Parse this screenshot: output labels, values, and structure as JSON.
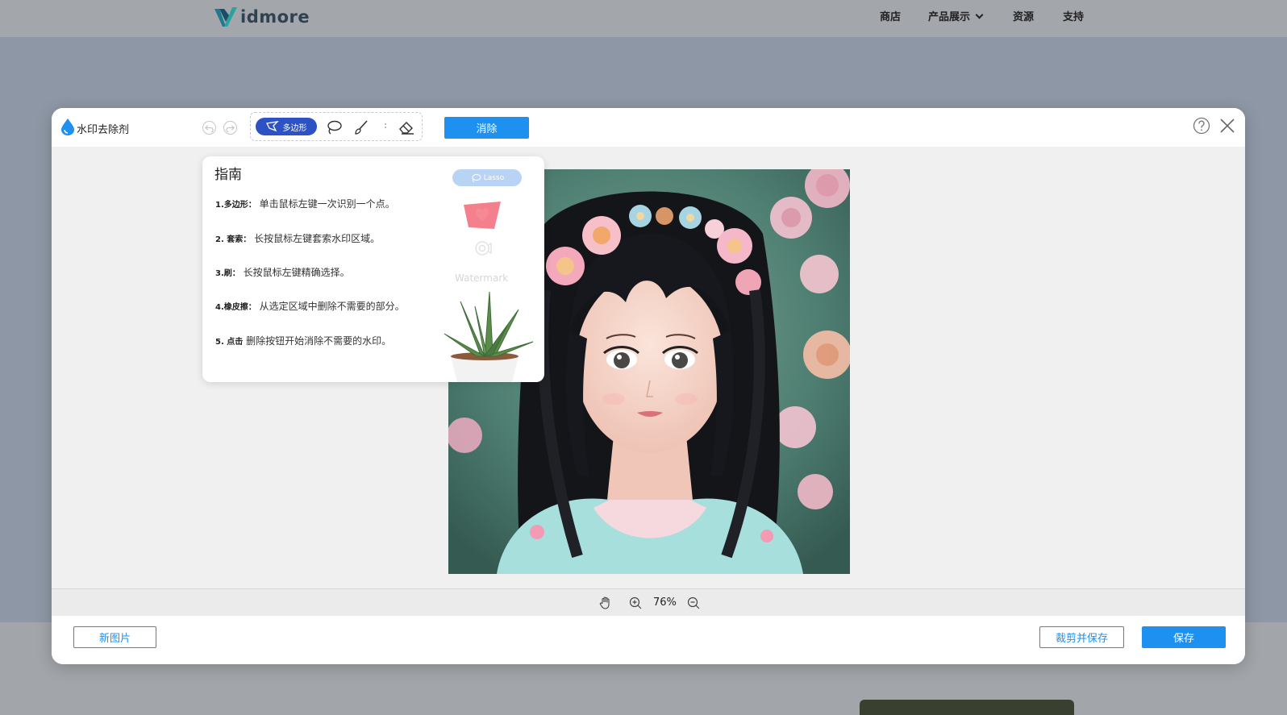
{
  "site": {
    "logo_text": "idmore",
    "nav": {
      "shop": "商店",
      "products": "产品展示",
      "resources": "资源",
      "support": "支持"
    }
  },
  "modal": {
    "title": "水印去除剂",
    "tools": {
      "polygon": "多边形",
      "lasso": "lasso-icon",
      "brush": "brush-icon",
      "eraser": "eraser-icon"
    },
    "erase_button": "消除",
    "zoom": "76%",
    "new_image_button": "新图片",
    "crop_save_button": "裁剪并保存",
    "save_button": "保存"
  },
  "guide": {
    "title": "指南",
    "items": [
      {
        "label": "1.多边形：",
        "text": "单击鼠标左键一次识别一个点。"
      },
      {
        "label": "2. 套索：",
        "text": "长按鼠标左键套索水印区域。"
      },
      {
        "label": "3.刷：",
        "text": "长按鼠标左键精确选择。"
      },
      {
        "label": "4.橡皮擦：",
        "text": "从选定区域中删除不需要的部分。"
      },
      {
        "label": "5. 点击",
        "text": "删除按钮开始消除不需要的水印。"
      }
    ],
    "demo_lasso": "Lasso",
    "demo_watermark": "Watermark"
  },
  "colors": {
    "accent": "#1e90f0",
    "polygon_active": "#2c52c6",
    "overlay": "#8e97a5"
  }
}
